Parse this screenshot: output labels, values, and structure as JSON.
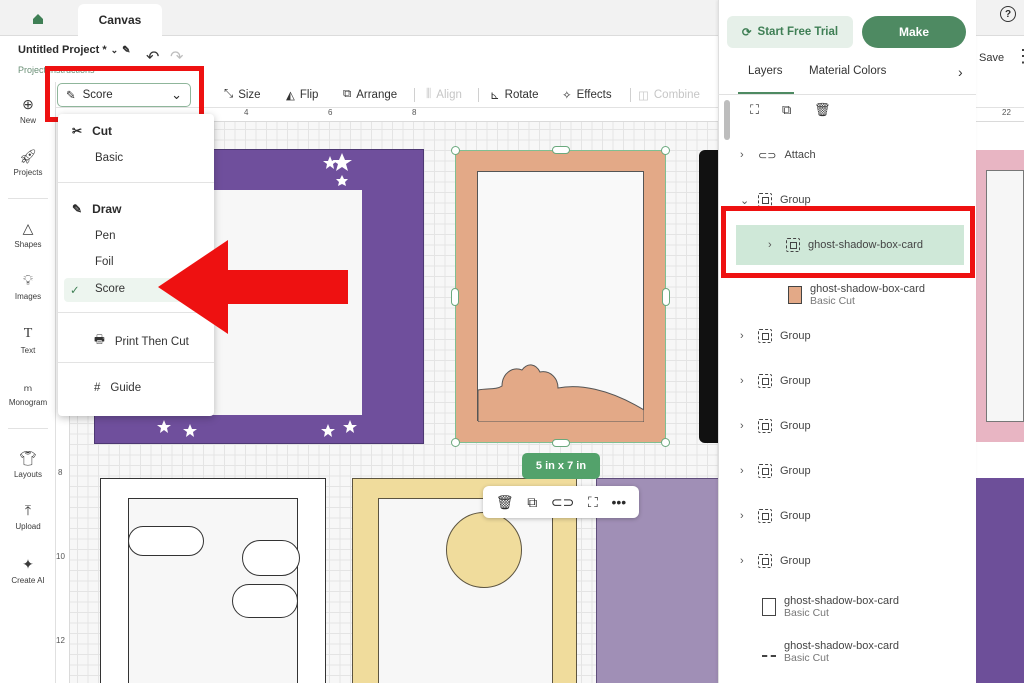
{
  "app": {
    "tab_title": "Canvas"
  },
  "project": {
    "title": "Untitled Project *",
    "instructions": "Project Instructions",
    "save_label": "Save"
  },
  "toolbar": {
    "linetype_value": "Score",
    "size": "Size",
    "flip": "Flip",
    "arrange": "Arrange",
    "align": "Align",
    "rotate": "Rotate",
    "effects": "Effects",
    "combine": "Combine"
  },
  "sidebar": {
    "items": [
      {
        "label": "New",
        "icon": "plus-circle-icon"
      },
      {
        "label": "Projects",
        "icon": "rocket-icon"
      },
      {
        "label": "Shapes",
        "icon": "shapes-icon"
      },
      {
        "label": "Images",
        "icon": "lightbulb-icon"
      },
      {
        "label": "Text",
        "icon": "text-icon"
      },
      {
        "label": "Monogram",
        "icon": "monogram-icon"
      },
      {
        "label": "Layouts",
        "icon": "tshirt-icon"
      },
      {
        "label": "Upload",
        "icon": "upload-icon"
      },
      {
        "label": "Create AI",
        "icon": "sparkle-icon"
      }
    ]
  },
  "linetype_menu": {
    "cut_heading": "Cut",
    "cut_items": [
      "Basic"
    ],
    "draw_heading": "Draw",
    "draw_items": [
      "Pen",
      "Foil",
      "Score"
    ],
    "selected": "Score",
    "print_then_cut": "Print Then Cut",
    "guide": "Guide"
  },
  "rulers": {
    "top": [
      "4",
      "6",
      "8",
      "22"
    ],
    "left": [
      "8",
      "10",
      "12"
    ]
  },
  "canvas": {
    "size_label": "5 in x 7 in"
  },
  "right_panel": {
    "start_free_trial": "Start Free Trial",
    "make": "Make",
    "tabs": [
      "Layers",
      "Material Colors"
    ],
    "layers": {
      "attach": "Attach",
      "group": "Group",
      "selected_group_name": "ghost-shadow-box-card",
      "child_name": "ghost-shadow-box-card",
      "child_type": "Basic Cut",
      "more_groups": [
        "Group",
        "Group",
        "Group",
        "Group",
        "Group",
        "Group"
      ],
      "bottom_items": [
        {
          "name": "ghost-shadow-box-card",
          "type": "Basic Cut"
        },
        {
          "name": "ghost-shadow-box-card",
          "type": "Basic Cut"
        }
      ]
    }
  },
  "colors": {
    "accent_green": "#4e8a62",
    "highlight_red": "#ee1111",
    "purple_card": "#6f4f9c",
    "peach_card": "#e3a987",
    "yellow_card": "#f0dc9c",
    "pink_card": "#e8b5c3"
  }
}
